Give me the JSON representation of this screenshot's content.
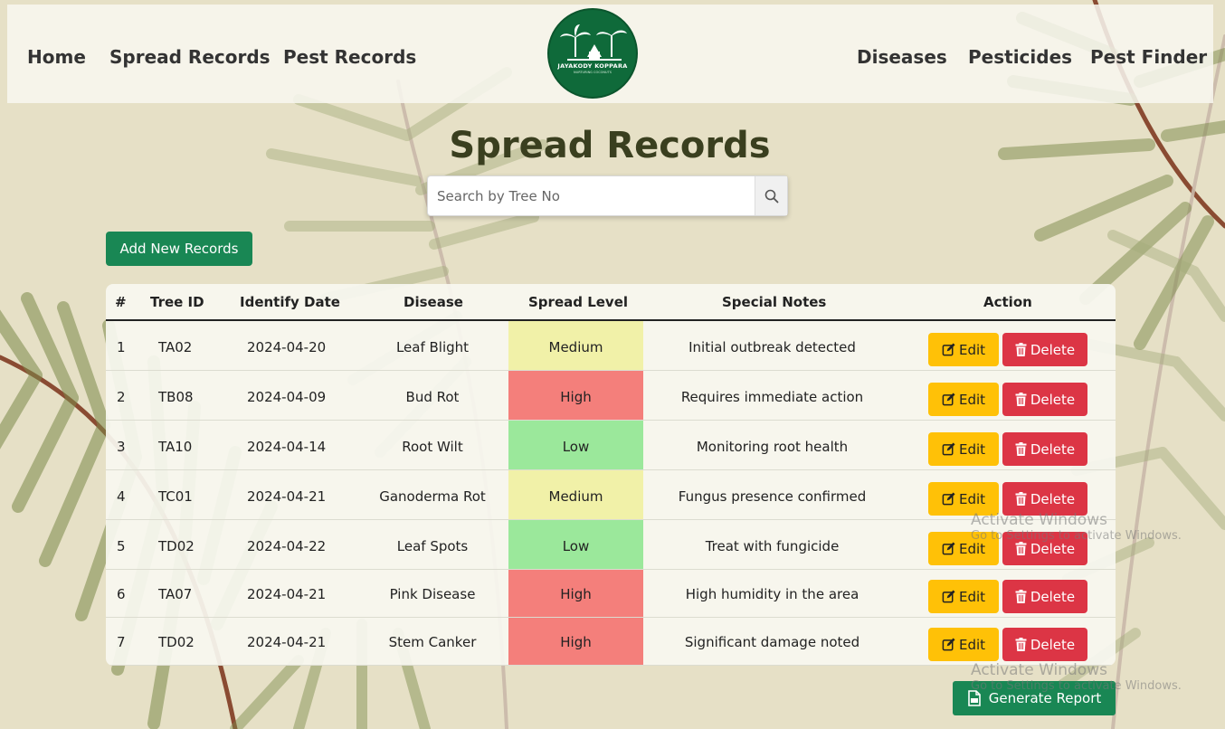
{
  "nav": {
    "left_links": [
      "Home",
      "Spread Records",
      "Pest Records"
    ],
    "right_links": [
      "Diseases",
      "Pesticides",
      "Pest Finder"
    ],
    "logo_text": "JAYAKODY KOPPARA",
    "logo_subtext": "NURTURING COCONUTS"
  },
  "page": {
    "title": "Spread Records"
  },
  "search": {
    "placeholder": "Search by Tree No",
    "icon": "search-icon"
  },
  "add_button_label": "Add New Records",
  "table": {
    "columns": [
      "#",
      "Tree ID",
      "Identify Date",
      "Disease",
      "Spread Level",
      "Special Notes",
      "Action"
    ],
    "rows": [
      {
        "num": "1",
        "tree_id": "TA02",
        "date": "2024-04-20",
        "disease": "Leaf Blight",
        "level": "Medium",
        "notes": "Initial outbreak detected"
      },
      {
        "num": "2",
        "tree_id": "TB08",
        "date": "2024-04-09",
        "disease": "Bud Rot",
        "level": "High",
        "notes": "Requires immediate action"
      },
      {
        "num": "3",
        "tree_id": "TA10",
        "date": "2024-04-14",
        "disease": "Root Wilt",
        "level": "Low",
        "notes": "Monitoring root health"
      },
      {
        "num": "4",
        "tree_id": "TC01",
        "date": "2024-04-21",
        "disease": "Ganoderma Rot",
        "level": "Medium",
        "notes": "Fungus presence confirmed"
      },
      {
        "num": "5",
        "tree_id": "TD02",
        "date": "2024-04-22",
        "disease": "Leaf Spots",
        "level": "Low",
        "notes": "Treat with fungicide"
      },
      {
        "num": "6",
        "tree_id": "TA07",
        "date": "2024-04-21",
        "disease": "Pink Disease",
        "level": "High",
        "notes": "High humidity in the area"
      },
      {
        "num": "7",
        "tree_id": "TD02",
        "date": "2024-04-21",
        "disease": "Stem Canker",
        "level": "High",
        "notes": "Significant damage noted"
      }
    ],
    "edit_label": "Edit",
    "delete_label": "Delete"
  },
  "level_colors": {
    "Low": "#9be89b",
    "Medium": "#f1f1a8",
    "High": "#f47f7b"
  },
  "report_button_label": "Generate Report",
  "watermark": {
    "title": "Activate Windows",
    "subtitle": "Go to Settings to activate Windows."
  }
}
